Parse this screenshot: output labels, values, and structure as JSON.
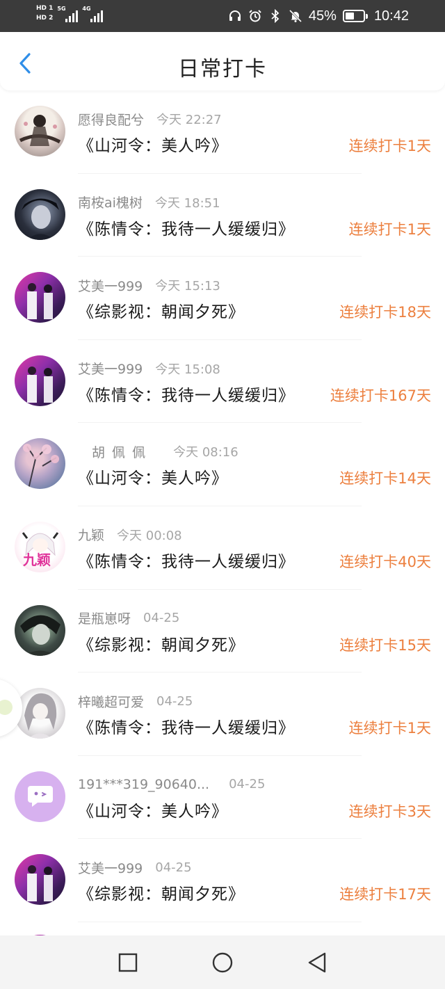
{
  "status_bar": {
    "sim1": "HD 1",
    "sim2": "HD 2",
    "network1": "5G",
    "network2": "4G",
    "battery_percent": "45%",
    "battery_level": 0.45,
    "time": "10:42",
    "icons": [
      "headphones-icon",
      "alarm-icon",
      "bluetooth-icon",
      "mute-icon",
      "battery-icon"
    ]
  },
  "header": {
    "title": "日常打卡",
    "back_icon": "chevron-left-icon",
    "accent_color": "#2f8ee8"
  },
  "colors": {
    "streak": "#ec7f3e",
    "username": "#8a8a8a",
    "book": "#1a1a1a"
  },
  "checkins": [
    {
      "user": "愿得良配兮",
      "time": "今天 22:27",
      "book": "《山河令：美人吟》",
      "streak": "连续打卡1天",
      "avatar": "ink-painting-avatar"
    },
    {
      "user": "南桉ai槐树",
      "time": "今天 18:51",
      "book": "《陈情令：我待一人缓缓归》",
      "streak": "连续打卡1天",
      "avatar": "dark-anime-avatar"
    },
    {
      "user": "艾美一999",
      "time": "今天 15:13",
      "book": "《综影视：朝闻夕死》",
      "streak": "连续打卡18天",
      "avatar": "purple-stage-avatar"
    },
    {
      "user": "艾美一999",
      "time": "今天 15:08",
      "book": "《陈情令：我待一人缓缓归》",
      "streak": "连续打卡167天",
      "avatar": "purple-stage-avatar"
    },
    {
      "user": "胡  佩  佩",
      "time": "今天 08:16",
      "book": "《山河令：美人吟》",
      "streak": "连续打卡14天",
      "avatar": "blossom-avatar"
    },
    {
      "user": "九颖",
      "time": "今天 00:08",
      "book": "《陈情令：我待一人缓缓归》",
      "streak": "连续打卡40天",
      "avatar": "anime-girl-avatar"
    },
    {
      "user": "是瓶崽呀",
      "time": "04-25",
      "book": "《综影视：朝闻夕死》",
      "streak": "连续打卡15天",
      "avatar": "green-anime-avatar"
    },
    {
      "user": "梓曦超可爱",
      "time": "04-25",
      "book": "《陈情令：我待一人缓缓归》",
      "streak": "连续打卡1天",
      "avatar": "sketch-avatar"
    },
    {
      "user": "191***319_90640...",
      "time": "04-25",
      "book": "《山河令：美人吟》",
      "streak": "连续打卡3天",
      "avatar": "chat-bubble-avatar"
    },
    {
      "user": "艾美一999",
      "time": "04-25",
      "book": "《综影视：朝闻夕死》",
      "streak": "连续打卡17天",
      "avatar": "purple-stage-avatar"
    }
  ],
  "nav_bar": {
    "icons": [
      "recents-square-icon",
      "home-circle-icon",
      "back-triangle-icon"
    ]
  }
}
